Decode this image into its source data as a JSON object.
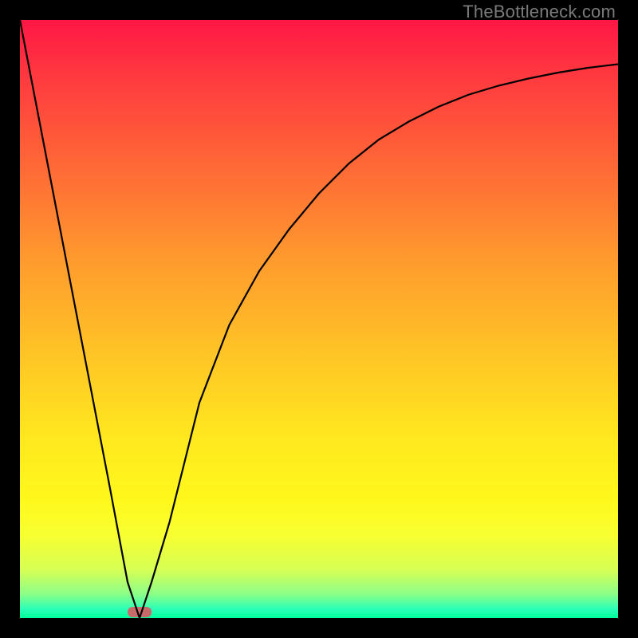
{
  "watermark": "TheBottleneck.com",
  "chart_data": {
    "type": "line",
    "title": "",
    "xlabel": "",
    "ylabel": "",
    "xlim": [
      0,
      100
    ],
    "ylim": [
      0,
      100
    ],
    "background_gradient": {
      "stops": [
        {
          "offset": 0.0,
          "color": "#ff1745"
        },
        {
          "offset": 0.1,
          "color": "#ff3b3f"
        },
        {
          "offset": 0.25,
          "color": "#ff6a36"
        },
        {
          "offset": 0.4,
          "color": "#ff9a2e"
        },
        {
          "offset": 0.55,
          "color": "#ffc226"
        },
        {
          "offset": 0.7,
          "color": "#ffe81f"
        },
        {
          "offset": 0.8,
          "color": "#fff81c"
        },
        {
          "offset": 0.86,
          "color": "#f8ff30"
        },
        {
          "offset": 0.92,
          "color": "#d6ff55"
        },
        {
          "offset": 0.96,
          "color": "#8bff88"
        },
        {
          "offset": 0.985,
          "color": "#2bffb7"
        },
        {
          "offset": 1.0,
          "color": "#00ff9c"
        }
      ]
    },
    "series": [
      {
        "name": "bottleneck-curve",
        "x": [
          0,
          5,
          10,
          15,
          18,
          20,
          22,
          25,
          28,
          30,
          35,
          40,
          45,
          50,
          55,
          60,
          65,
          70,
          75,
          80,
          85,
          90,
          95,
          100
        ],
        "y": [
          100,
          74,
          48,
          22,
          6,
          0,
          6,
          16,
          28,
          36,
          49,
          58,
          65,
          71,
          76,
          80,
          83,
          85.5,
          87.5,
          89,
          90.2,
          91.2,
          92,
          92.6
        ]
      }
    ],
    "marker": {
      "name": "optimal-marker",
      "x_center": 20,
      "width": 4,
      "color": "#c86a6a"
    }
  }
}
